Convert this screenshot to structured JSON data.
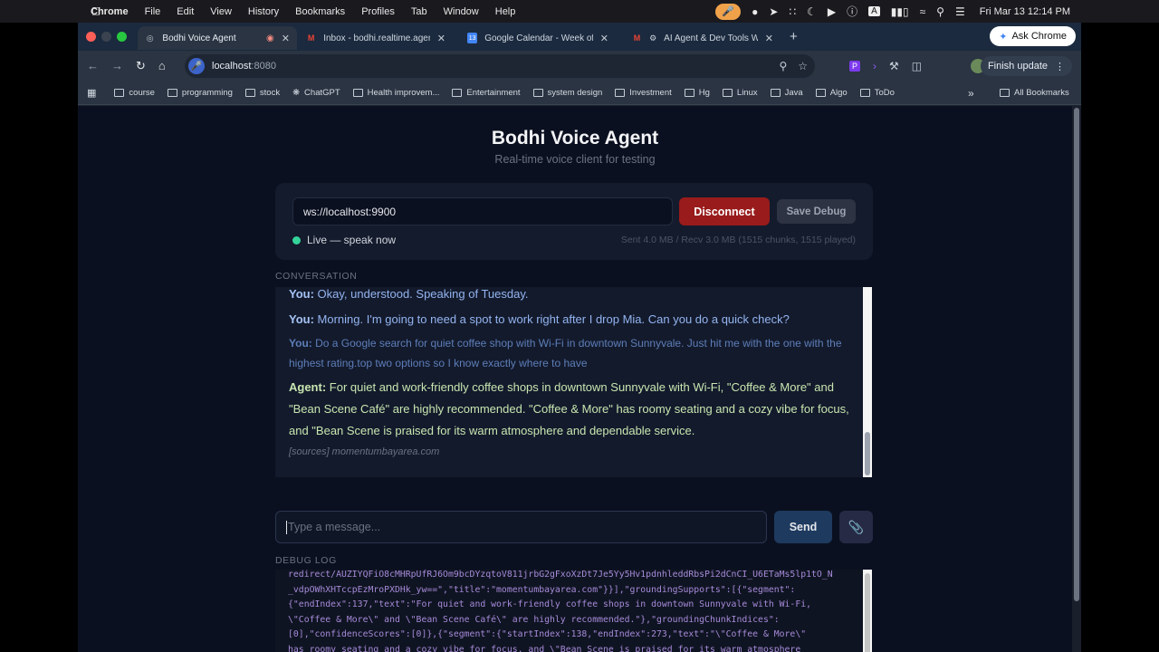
{
  "menubar": {
    "apple": "",
    "app": "Chrome",
    "items": [
      "File",
      "Edit",
      "View",
      "History",
      "Bookmarks",
      "Profiles",
      "Tab",
      "Window",
      "Help"
    ],
    "datetime": "Fri Mar 13  12:14 PM"
  },
  "tabs": [
    {
      "title": "Bodhi Voice Agent",
      "icon": "globe-icon"
    },
    {
      "title": "Inbox - bodhi.realtime.agent@",
      "icon": "gmail-icon"
    },
    {
      "title": "Google Calendar - Week of M",
      "icon": "calendar-icon"
    },
    {
      "title": "AI Agent & Dev Tools Wee",
      "icon": "gmail-icon"
    }
  ],
  "toolbar": {
    "url_host": "localhost",
    "url_port": ":8080",
    "ask_chrome": "Ask Chrome",
    "finish_update": "Finish update"
  },
  "bookmarks": [
    "course",
    "programming",
    "stock",
    "ChatGPT",
    "Health improvem...",
    "Entertainment",
    "system design",
    "Investment",
    "Hg",
    "Linux",
    "Java",
    "Algo",
    "ToDo"
  ],
  "all_bookmarks": "All Bookmarks",
  "app": {
    "title": "Bodhi Voice Agent",
    "subtitle": "Real-time voice client for testing",
    "ws_url": "ws://localhost:9900",
    "disconnect_label": "Disconnect",
    "save_debug_label": "Save Debug",
    "status": "Live — speak now",
    "stats": "Sent 4.0 MB / Recv 3.0 MB (1515 chunks, 1515 played)",
    "conversation_label": "CONVERSATION",
    "debug_label": "DEBUG LOG",
    "message_placeholder": "Type a message...",
    "send_label": "Send"
  },
  "conversation": [
    {
      "speaker": "You:",
      "text": " Okay, understood. Speaking of Tuesday."
    },
    {
      "speaker": "You:",
      "text": " Morning. I'm going to need a spot to work right after I drop Mia. Can you do a quick check?"
    },
    {
      "speaker": "You:",
      "text": " Do a Google search for quiet coffee shop with Wi-Fi in downtown Sunnyvale. Just hit me with the one with the highest rating.top two options so I know exactly where to have"
    },
    {
      "speaker": "Agent:",
      "text": " For quiet and work-friendly coffee shops in downtown Sunnyvale with Wi-Fi, \"Coffee & More\" and \"Bean Scene Café\" are highly recommended. \"Coffee & More\" has roomy seating and a cozy vibe for focus, and \"Bean Scene is praised for its warm atmosphere and dependable service."
    }
  ],
  "sources": "[sources] momentumbayarea.com",
  "debug_log": "redirect/AUZIYQFiO8cMHRpUfRJ6Om9bcDYzqtoV811jrbG2gFxoXzDt7Je5Yy5Hv1pdnhleddRbsPi2dCnCI_U6ETaMs5lp1tO_N\n_vdpOWhXHTccpEzMroPXDHk_yw==\",\"title\":\"momentumbayarea.com\"}}],\"groundingSupports\":[{\"segment\":\n{\"endIndex\":137,\"text\":\"For quiet and work-friendly coffee shops in downtown Sunnyvale with Wi-Fi,\n\\\"Coffee & More\\\" and \\\"Bean Scene Café\\\" are highly recommended.\"},\"groundingChunkIndices\":\n[0],\"confidenceScores\":[0]},{\"segment\":{\"startIndex\":138,\"endIndex\":273,\"text\":\"\\\"Coffee & More\\\"\nhas roomy seating and a cozy vibe for focus, and \\\"Bean Scene is praised for its warm atmosphere\nand dependable service.\"},\"groundingChunkIndices\":[0],\"confidenceScores\":[0]}],\"webSearchQueries\":"
}
